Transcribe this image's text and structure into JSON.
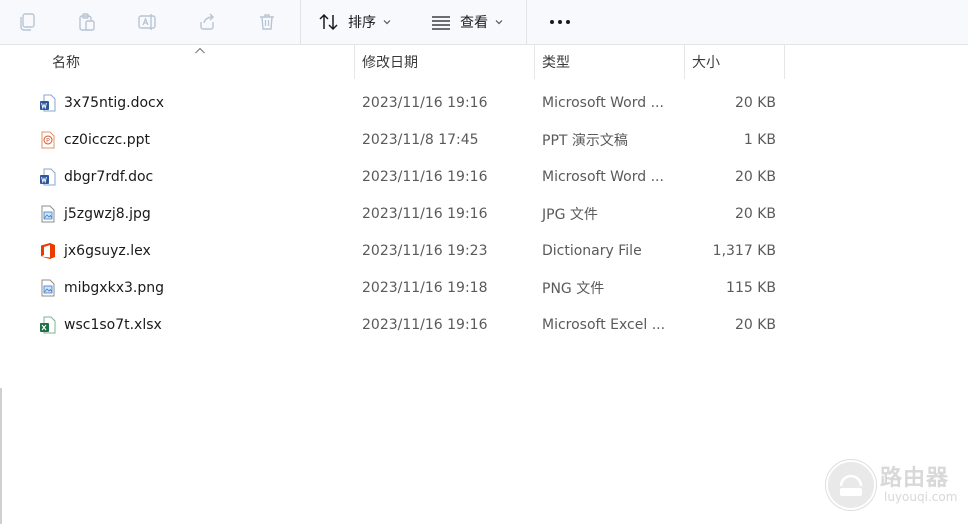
{
  "toolbar": {
    "copy_icon": "copy-icon",
    "paste_icon": "paste-icon",
    "rename_icon": "rename-icon",
    "share_icon": "share-icon",
    "delete_icon": "delete-icon",
    "sort_label": "排序",
    "view_label": "查看",
    "more_label": "•••"
  },
  "columns": {
    "name": "名称",
    "date": "修改日期",
    "type": "类型",
    "size": "大小"
  },
  "files": [
    {
      "name": "3x75ntig.docx",
      "date": "2023/11/16 19:16",
      "type": "Microsoft Word ...",
      "size": "20 KB",
      "icon": "word"
    },
    {
      "name": "cz0icczc.ppt",
      "date": "2023/11/8 17:45",
      "type": "PPT 演示文稿",
      "size": "1 KB",
      "icon": "ppt"
    },
    {
      "name": "dbgr7rdf.doc",
      "date": "2023/11/16 19:16",
      "type": "Microsoft Word ...",
      "size": "20 KB",
      "icon": "word"
    },
    {
      "name": "j5zgwzj8.jpg",
      "date": "2023/11/16 19:16",
      "type": "JPG 文件",
      "size": "20 KB",
      "icon": "image"
    },
    {
      "name": "jx6gsuyz.lex",
      "date": "2023/11/16 19:23",
      "type": "Dictionary File",
      "size": "1,317 KB",
      "icon": "office"
    },
    {
      "name": "mibgxkx3.png",
      "date": "2023/11/16 19:18",
      "type": "PNG 文件",
      "size": "115 KB",
      "icon": "image"
    },
    {
      "name": "wsc1so7t.xlsx",
      "date": "2023/11/16 19:16",
      "type": "Microsoft Excel ...",
      "size": "20 KB",
      "icon": "excel"
    }
  ],
  "watermark": {
    "title": "路由器",
    "subtitle": "luyouqi.com"
  },
  "colors": {
    "word": "#2b5797",
    "ppt": "#d35230",
    "excel": "#1e7145",
    "office": "#eb3c00",
    "toolbar_bg": "#f7f9fc"
  }
}
